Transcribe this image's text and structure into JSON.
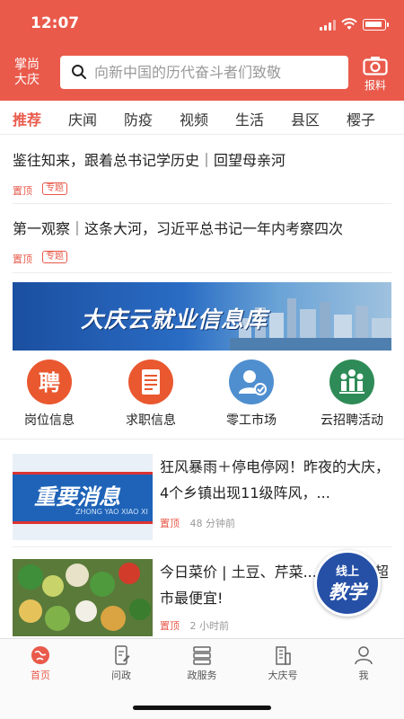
{
  "status": {
    "time": "12:07"
  },
  "header": {
    "logo": "掌尚\n大庆",
    "search_placeholder": "向新中国的历代奋斗者们致敬",
    "camera_label": "报料"
  },
  "tabs": [
    {
      "label": "推荐",
      "active": true
    },
    {
      "label": "庆闻"
    },
    {
      "label": "防疫"
    },
    {
      "label": "视频"
    },
    {
      "label": "生活"
    },
    {
      "label": "县区"
    },
    {
      "label": "樱子"
    }
  ],
  "top_news": [
    {
      "title": "鉴往知来，跟着总书记学历史｜回望母亲河",
      "tag": "置顶",
      "badge": "专题"
    },
    {
      "title": "第一观察｜这条大河，习近平总书记一年内考察四次",
      "tag": "置顶",
      "badge": "专题"
    }
  ],
  "banner": {
    "title": "大庆云就业信息库"
  },
  "services": [
    {
      "label": "岗位信息",
      "icon": "hire-icon",
      "color": "#e9582f"
    },
    {
      "label": "求职信息",
      "icon": "resume-icon",
      "color": "#e9582f"
    },
    {
      "label": "零工市场",
      "icon": "worker-icon",
      "color": "#4f8fd0"
    },
    {
      "label": "云招聘活动",
      "icon": "group-icon",
      "color": "#2e8b57"
    }
  ],
  "image_news": [
    {
      "title": "狂风暴雨＋停电停网！昨夜的大庆，4个乡镇出现11级阵风，...",
      "tag": "置顶",
      "time": "48 分钟前",
      "thumb_text": "重要消息",
      "thumb_sub": "ZHONG YAO XIAO XI"
    },
    {
      "title": "今日菜价 | 土豆、芹菜...来看哪家超市最便宜!",
      "tag": "置顶",
      "time": "2 小时前"
    }
  ],
  "edu_button": {
    "line1": "线上",
    "line2": "教学"
  },
  "bottom_nav": [
    {
      "label": "首页",
      "icon": "home-globe-icon",
      "active": true
    },
    {
      "label": "问政",
      "icon": "phone-edit-icon"
    },
    {
      "label": "政服务",
      "icon": "server-icon"
    },
    {
      "label": "大庆号",
      "icon": "building-icon"
    },
    {
      "label": "我",
      "icon": "user-icon"
    }
  ]
}
